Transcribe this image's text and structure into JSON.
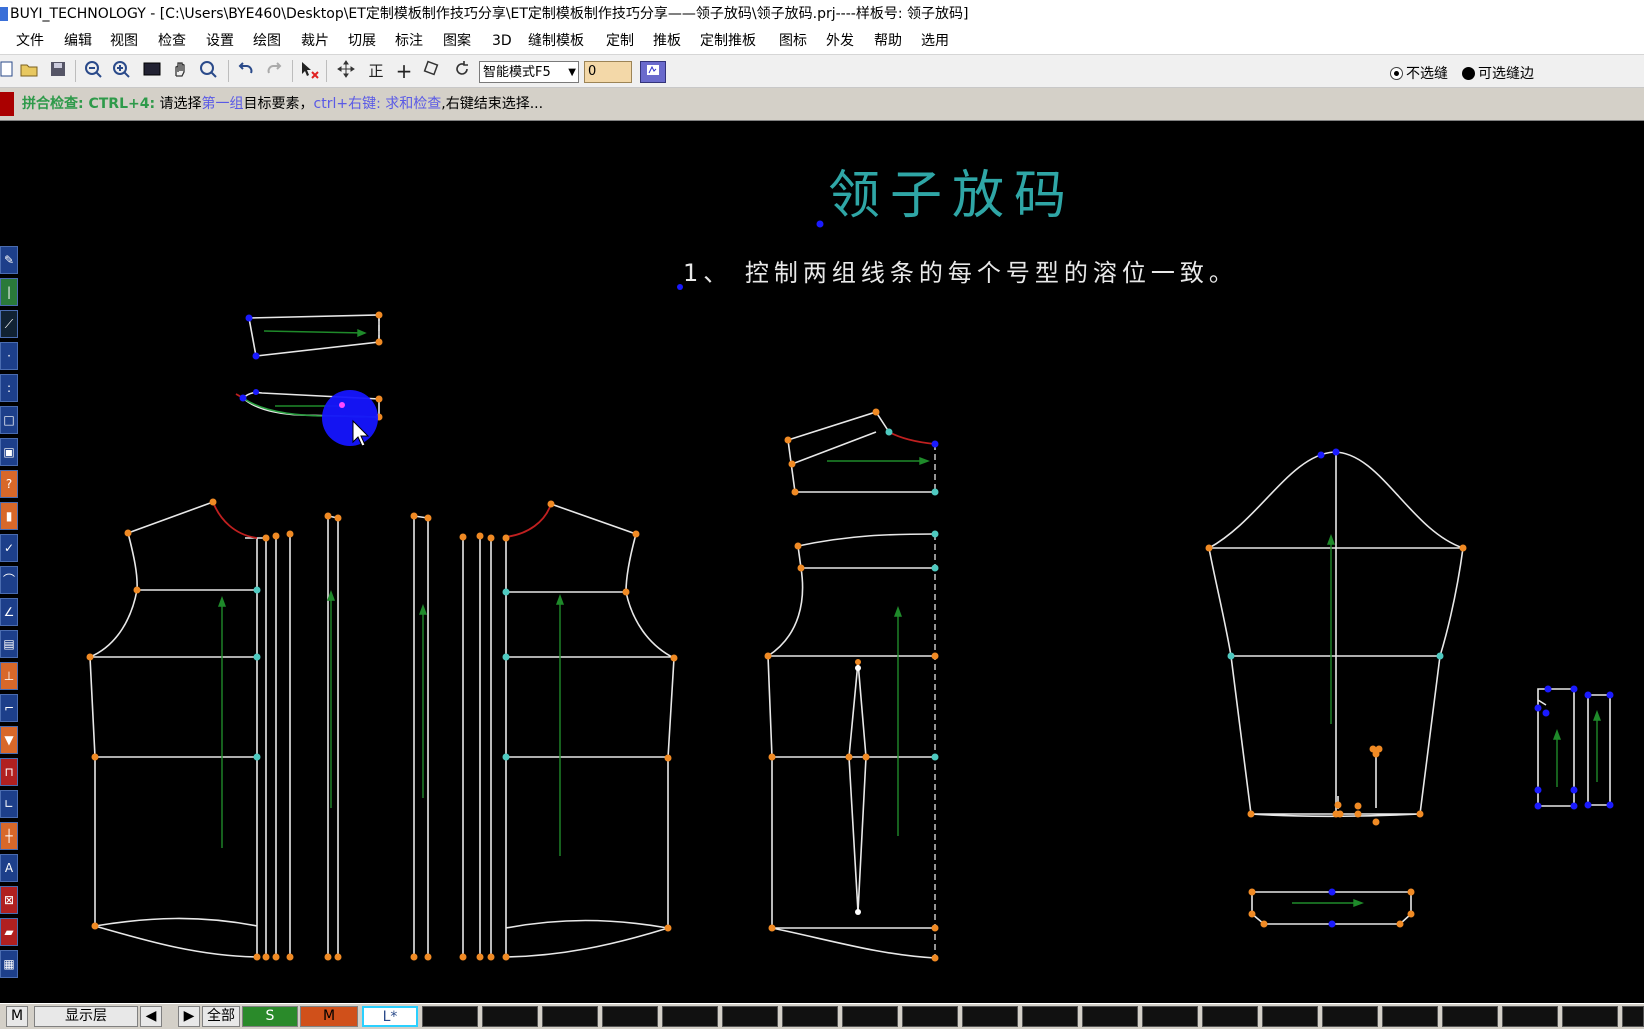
{
  "window": {
    "title": "BUYI_TECHNOLOGY - [C:\\Users\\BYE460\\Desktop\\ET定制模板制作技巧分享\\ET定制模板制作技巧分享——领子放码\\领子放码.prj----样板号: 领子放码]"
  },
  "menu": [
    "文件",
    "编辑",
    "视图",
    "检查",
    "设置",
    "绘图",
    "裁片",
    "切展",
    "标注",
    "图案",
    "3D",
    "缝制模板",
    "定制",
    "推板",
    "定制推板",
    "图标",
    "外发",
    "帮助",
    "选用"
  ],
  "toolbar": {
    "mode_select": "智能模式F5",
    "value_input": "0",
    "radio_no_seam": "不选缝",
    "radio_seam": "可选缝边",
    "icons": [
      "new-icon",
      "open-icon",
      "save-icon",
      "zoom-out-icon",
      "zoom-in-icon",
      "fit-icon",
      "pan-icon",
      "zoom-window-icon",
      "undo-icon",
      "redo-icon",
      "delete-select-icon",
      "move-icon",
      "straight-icon",
      "cross-icon",
      "rotate-sq-icon",
      "rotate-icon"
    ],
    "glyphs": {
      "straight": "正",
      "cross": "+"
    }
  },
  "prompt": {
    "part1": "拼合检查: CTRL+4:",
    "part2": " 请选择",
    "part3": "第一组",
    "part4": "目标要素，",
    "part5": "ctrl+右键: 求和检查",
    "part6": ",右键结束选择..."
  },
  "canvas": {
    "heading": "领子放码",
    "note": "1、 控制两组线条的每个号型的溶位一致。"
  },
  "status": {
    "m_label": "M",
    "layer_label": "显示层",
    "all_label": "全部",
    "sizes": [
      {
        "label": "S",
        "color": "#2a8a2a"
      },
      {
        "label": "M",
        "color": "#d0501a"
      },
      {
        "label": "L*",
        "color": "#ffffff"
      }
    ]
  },
  "colors": {
    "line": "#e8e8e8",
    "point_orange": "#f08a24",
    "point_cyan": "#4ec9c0",
    "point_blue": "#1a1aff",
    "grain": "#1f8a2a",
    "neck_red": "#c02020",
    "heading": "#2fa6a6"
  }
}
